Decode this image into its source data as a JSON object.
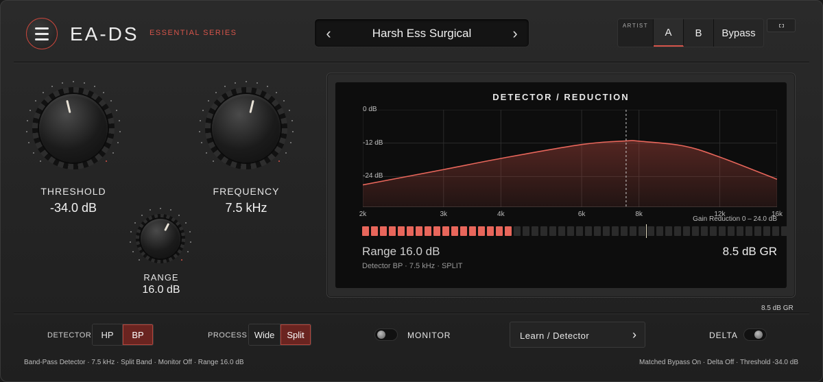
{
  "header": {
    "brand": "EA-DS",
    "series": "ESSENTIAL SERIES",
    "preset_name": "Harsh Ess Surgical",
    "prev_glyph": "‹",
    "next_glyph": "›",
    "artist_label": "ARTIST",
    "a_label": "A",
    "b_label": "B",
    "bypass_label": "Bypass",
    "active_slot": "A"
  },
  "knobs": {
    "threshold": {
      "label": "THRESHOLD",
      "value": "-34.0 dB",
      "level": 0.45
    },
    "frequency": {
      "label": "FREQUENCY",
      "value": "7.5 kHz",
      "level": 0.55
    },
    "range": {
      "label": "RANGE",
      "value": "16.0 dB",
      "level": 0.6
    }
  },
  "display": {
    "title": "DETECTOR / REDUCTION",
    "y_ticks": [
      "0 dB",
      "-12 dB",
      "-24 dB"
    ],
    "x_ticks": [
      "2k",
      "3k",
      "4k",
      "6k",
      "8k",
      "12k",
      "16k"
    ],
    "gain_reduction_range": "Gain Reduction  0 – 24.0 dB",
    "range_readout": "Range 16.0 dB",
    "gr_readout": "8.5 dB GR",
    "sub_readout": "Detector BP · 7.5 kHz · SPLIT",
    "meter_cells_total": 48,
    "meter_cells_lit": 17,
    "meter_marker_fraction": 0.667
  },
  "chart_data": {
    "type": "area",
    "title": "DETECTOR / REDUCTION",
    "x_scale": "log",
    "x": [
      2000,
      3000,
      4000,
      6000,
      7500,
      8000,
      10000,
      12000,
      16000
    ],
    "y": [
      -27,
      -21.5,
      -17.5,
      -12.5,
      -11.2,
      -11.3,
      -13,
      -17,
      -25
    ],
    "ylim": [
      -35,
      0
    ],
    "xlim": [
      2000,
      16000
    ],
    "marker_x": 7500,
    "grid": true,
    "color": "#e8665b"
  },
  "gr_under_display": "8.5 dB GR",
  "controls": {
    "detector_label": "DETECTOR",
    "detector_options": [
      "HP",
      "BP"
    ],
    "detector_selected": "BP",
    "process_label": "PROCESS",
    "process_options": [
      "Wide",
      "Split"
    ],
    "process_selected": "Split",
    "monitor_label": "MONITOR",
    "learn_label": "Learn / Detector",
    "learn_chevron": "›",
    "delta_label": "DELTA"
  },
  "status": {
    "left": "Band-Pass Detector · 7.5 kHz · Split Band · Monitor Off · Range 16.0 dB",
    "right": "Matched Bypass On · Delta Off · Threshold -34.0 dB"
  },
  "colors": {
    "accent": "#d6544a",
    "meter_on": "#e8665b",
    "selected_bg": "#6a2420"
  }
}
